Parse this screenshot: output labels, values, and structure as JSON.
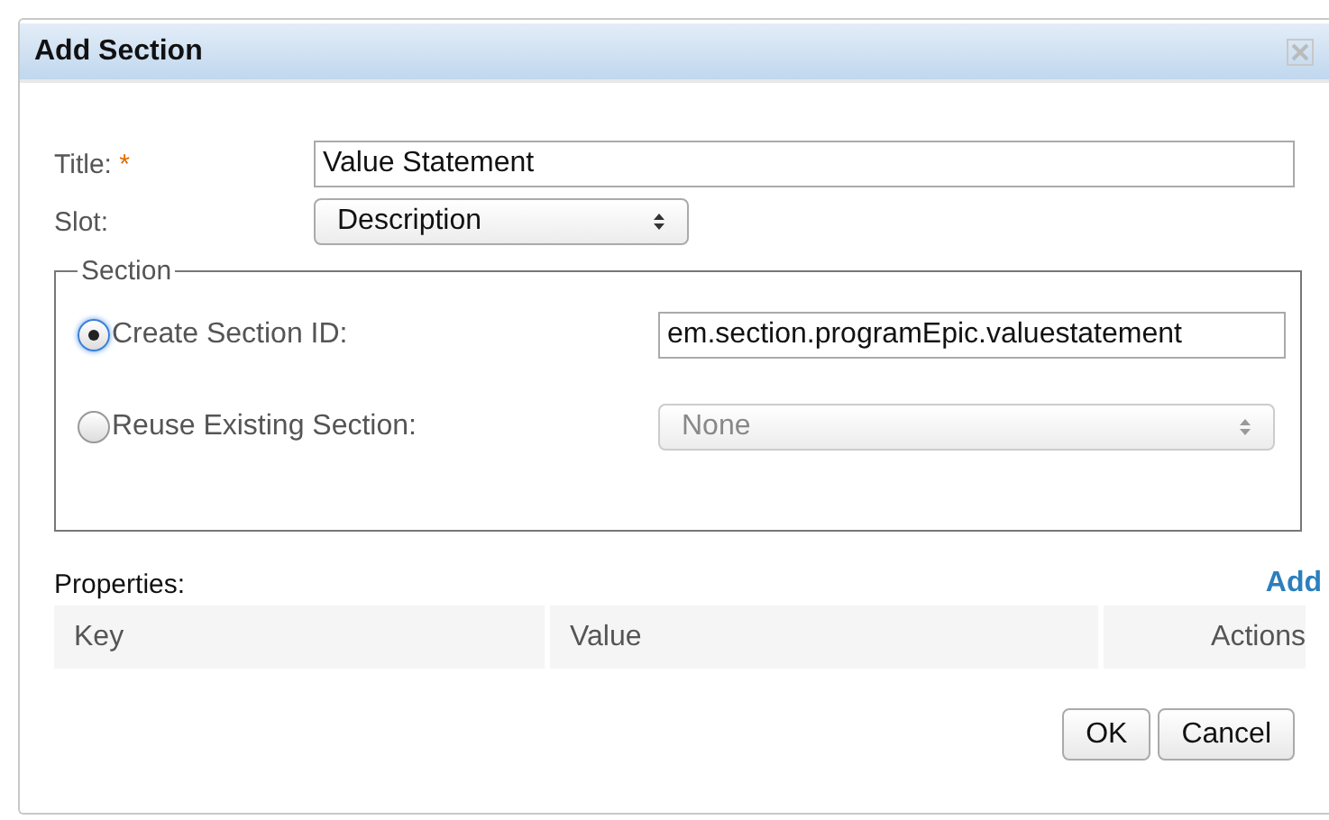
{
  "window": {
    "title": "Add Section"
  },
  "title_field": {
    "label": "Title:",
    "required_mark": "*",
    "value": "Value Statement"
  },
  "slot_field": {
    "label": "Slot:",
    "value": "Description"
  },
  "section": {
    "legend": "Section",
    "options": [
      {
        "label": "Create Section ID:",
        "selected": true,
        "kind": "text",
        "value": "em.section.programEpic.valuestatement",
        "disabled": false
      },
      {
        "label": "Reuse Existing Section:",
        "selected": false,
        "kind": "select",
        "value": "None",
        "disabled": true
      }
    ]
  },
  "properties": {
    "label": "Properties:",
    "add_link": "Add",
    "columns": [
      "Key",
      "Value",
      "Actions"
    ]
  },
  "buttons": [
    "OK",
    "Cancel"
  ]
}
